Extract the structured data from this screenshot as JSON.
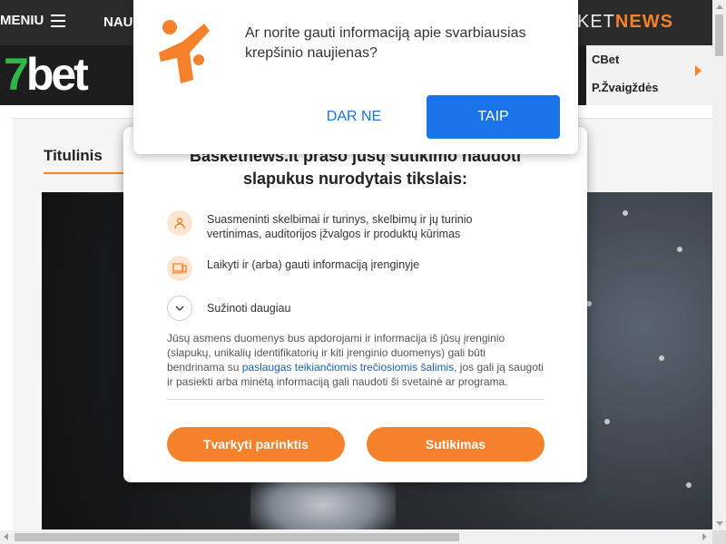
{
  "nav": {
    "menu_label": "MENIU",
    "partial_link": "NAU",
    "brand_prefix": "KET",
    "brand_suffix": "NEWS"
  },
  "banner": {
    "logo_number": "7",
    "logo_text": "bet",
    "ad_items": [
      "CBet",
      "P.Žvaigždės"
    ]
  },
  "content": {
    "tab_label": "Titulinis"
  },
  "consent": {
    "title": "Basketnews.lt prašo jūsų sutikimo naudoti slapukus nurodytais tikslais:",
    "purposes": [
      {
        "icon": "person-icon",
        "text": "Suasmeninti skelbimai ir turinys, skelbimų ir jų turinio vertinimas, auditorijos įžvalgos ir produktų kūrimas"
      },
      {
        "icon": "devices-icon",
        "text": "Laikyti ir (arba) gauti informaciją įrenginyje"
      },
      {
        "icon": "chevron-down-icon",
        "text": "Sužinoti daugiau"
      }
    ],
    "body_before": "Jūsų asmens duomenys bus apdorojami ir informacija iš jūsų įrenginio (slapukų, unikalių identifikatorių ir kiti įrenginio duomenys) gali būti bendrinama su ",
    "body_link": "paslaugas teikiančiomis trečiosiomis šalimis",
    "body_after": ", jos gali ją saugoti ir pasiekti arba minėtą informaciją gali naudoti ši svetainė ar programa.",
    "manage_label": "Tvarkyti parinktis",
    "accept_label": "Sutikimas",
    "accent_color": "#f5822a"
  },
  "push": {
    "question": "Ar norite gauti informaciją apie svarbiausias krepšinio naujienas?",
    "decline_label": "DAR NE",
    "accept_label": "TAIP",
    "accent_color": "#1a73e8"
  }
}
